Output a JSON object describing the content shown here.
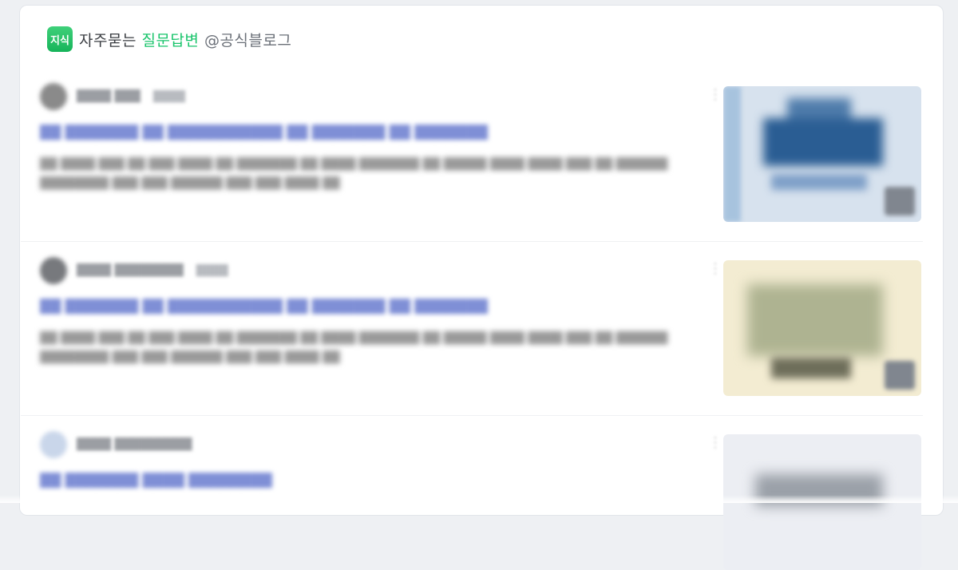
{
  "header": {
    "icon_glyph": "지식",
    "prefix": "자주묻는",
    "accent": "질문답변",
    "suffix": "@공식블로그"
  },
  "colors": {
    "accent": "#19c46b",
    "title_link": "#7f8fd6"
  },
  "items": [
    {
      "author": "████ ███",
      "date": "████",
      "title": "██ ███████ ██ ███████████ ██ ███████ ██ ███████",
      "snippet": "██ ████ ███ ██ ███ ████ ██ ███████ ██ ████ ███████ ██ █████ ████ ████ ███ ██ ██████ ████████ ███ ███ ██████ ███ ███ ████ ██",
      "more_icon": "more-vertical-icon",
      "thumbnail": "blog-thumbnail"
    },
    {
      "author": "████ ████████",
      "date": "████",
      "title": "██ ███████ ██ ███████████ ██ ███████ ██ ███████",
      "snippet": "██ ████ ███ ██ ███ ████ ██ ███████ ██ ████ ███████ ██ █████ ████ ████ ███ ██ ██████ ████████ ███ ███ ██████ ███ ███ ████ ██",
      "more_icon": "more-vertical-icon",
      "thumbnail": "blog-thumbnail"
    },
    {
      "author": "████ █████████",
      "date": "",
      "title": "██ ███████ ████ ████████",
      "snippet": "",
      "more_icon": "more-vertical-icon",
      "thumbnail": "blog-thumbnail"
    }
  ]
}
